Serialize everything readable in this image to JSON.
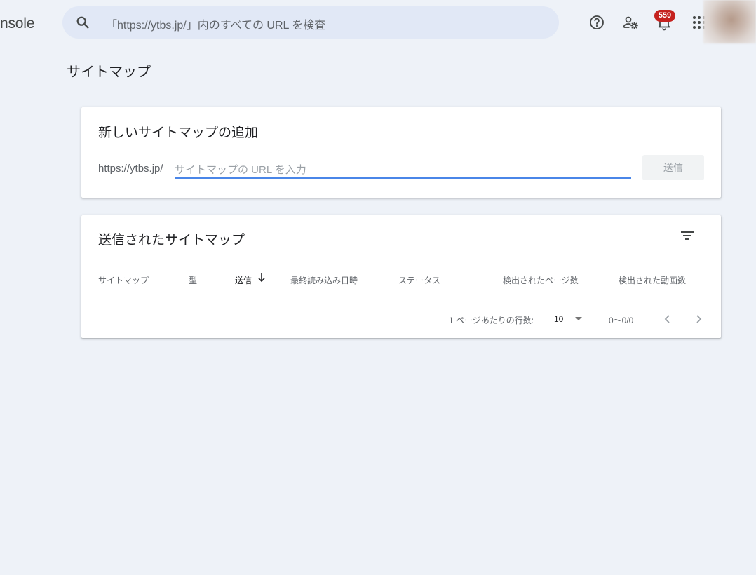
{
  "header": {
    "app_name": "nsole",
    "search_placeholder": "「https://ytbs.jp/」内のすべての URL を検査",
    "notification_count": "559",
    "icons": [
      "search-icon",
      "help-icon",
      "manage-users-icon",
      "notifications-icon",
      "apps-icon",
      "avatar"
    ]
  },
  "page": {
    "title": "サイトマップ"
  },
  "add_sitemap": {
    "title": "新しいサイトマップの追加",
    "url_prefix": "https://ytbs.jp/",
    "input_placeholder": "サイトマップの URL を入力",
    "input_value": "",
    "submit_label": "送信"
  },
  "submitted": {
    "title": "送信されたサイトマップ",
    "columns": [
      "サイトマップ",
      "型",
      "送信",
      "最終読み込み日時",
      "ステータス",
      "検出されたページ数",
      "検出された動画数"
    ],
    "sorted_column": "送信",
    "rows": []
  },
  "pagination": {
    "rows_label": "1 ページあたりの行数:",
    "rows_value": "10",
    "range": "0〜0/0"
  },
  "colors": {
    "accent": "#4a86e8",
    "badge": "#c5221f",
    "background": "#eef2f8"
  }
}
